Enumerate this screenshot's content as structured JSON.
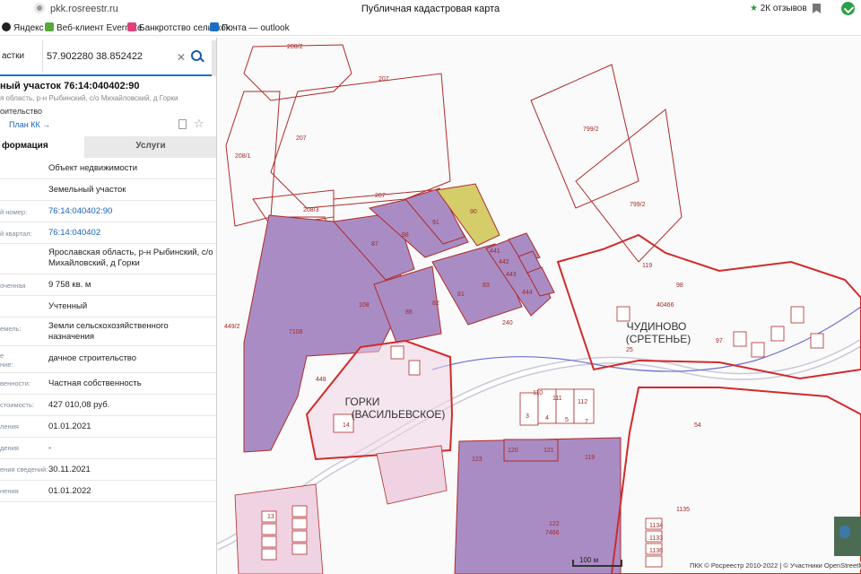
{
  "browser": {
    "url": "pkk.rosreestr.ru",
    "page_title": "Публичная кадастровая карта",
    "reviews": "2К отзывов"
  },
  "bookmarks": [
    {
      "label": "Яндекс"
    },
    {
      "label": "Веб-клиент Evernote"
    },
    {
      "label": "Банкротство сельскох..."
    },
    {
      "label": "Почта — outlook"
    }
  ],
  "search": {
    "type_label": "астки",
    "value": "57.902280 38.852422"
  },
  "object": {
    "title": "ный участок 76:14:040402:90",
    "address": "я область, р-н Рыбинский, с/о Михайловский, д Горки",
    "use": "оительство",
    "plan_link": "План КК →"
  },
  "tabs": {
    "info": "формация",
    "services": "Услуги"
  },
  "info_rows": [
    {
      "label": "",
      "value": "Объект недвижимости"
    },
    {
      "label": "",
      "value": "Земельный участок"
    },
    {
      "label": "й номер:",
      "value": "76:14:040402:90"
    },
    {
      "label": "й квартал:",
      "value": "76:14:040402"
    },
    {
      "label": "",
      "value": "Ярославская область, р-н Рыбинский, с/о Михайловский, д Горки"
    },
    {
      "label": "оченная",
      "value": "9 758 кв. м"
    },
    {
      "label": "",
      "value": "Учтенный"
    },
    {
      "label": "емель:",
      "value": "Земли сельскохозяйственного назначения"
    },
    {
      "label": "е\nние:",
      "value": "дачное строительство"
    },
    {
      "label": "венности:",
      "value": "Частная собственность"
    },
    {
      "label": "стоимость:",
      "value": "427 010,08 руб."
    },
    {
      "label": "ления",
      "value": "01.01.2021"
    },
    {
      "label": "дения",
      "value": "-"
    },
    {
      "label": "ения сведений:",
      "value": "30.11.2021"
    },
    {
      "label": "нения",
      "value": "01.01.2022"
    }
  ],
  "map": {
    "villages": [
      {
        "name_line1": "ГОРКИ",
        "name_line2": "(ВАСИЛЬЕВСКОЕ)"
      },
      {
        "name_line1": "ЧУДИНОВО",
        "name_line2": "(СРЕТЕНЬЕ)"
      }
    ],
    "parcel_labels": [
      "208/2",
      "207",
      "208/1",
      "207",
      "208/3",
      "207",
      "799/2",
      "799/2",
      "90",
      "91",
      "88",
      "87",
      "441",
      "442",
      "443",
      "444",
      "83",
      "81",
      "82",
      "86",
      "108",
      "7108",
      "449/2",
      "448",
      "240",
      "40466",
      "119",
      "98",
      "25",
      "97",
      "54",
      "110",
      "111",
      "112",
      "3",
      "4",
      "5",
      "7",
      "123",
      "120",
      "121",
      "119",
      "122",
      "7466",
      "13",
      "14",
      "1135",
      "1134",
      "1133",
      "1136"
    ],
    "scale": "100 м",
    "attribution": "ПКК © Росреестр 2010-2022 | © Участники OpenStreetMap"
  }
}
